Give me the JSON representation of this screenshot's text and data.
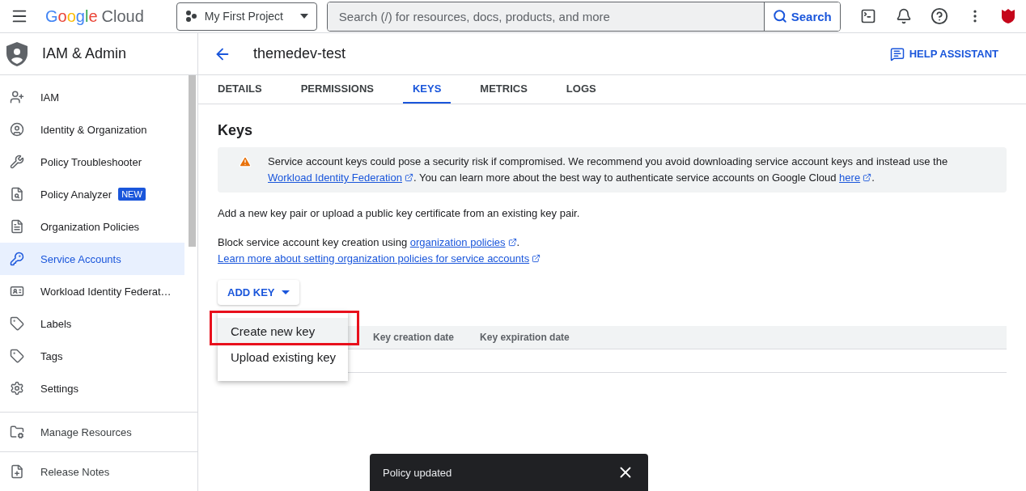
{
  "topbar": {
    "logo": {
      "brand": "Google",
      "product": "Cloud"
    },
    "project": "My First Project",
    "search": {
      "placeholder": "Search (/) for resources, docs, products, and more",
      "button": "Search"
    }
  },
  "sidebar": {
    "title": "IAM & Admin",
    "items": [
      {
        "label": "IAM",
        "selected": false
      },
      {
        "label": "Identity & Organization",
        "selected": false
      },
      {
        "label": "Policy Troubleshooter",
        "selected": false
      },
      {
        "label": "Policy Analyzer",
        "badge": "NEW",
        "selected": false
      },
      {
        "label": "Organization Policies",
        "selected": false
      },
      {
        "label": "Service Accounts",
        "selected": true
      },
      {
        "label": "Workload Identity Federat…",
        "selected": false
      },
      {
        "label": "Labels",
        "selected": false
      },
      {
        "label": "Tags",
        "selected": false
      },
      {
        "label": "Settings",
        "selected": false
      }
    ],
    "footer": [
      "Manage Resources",
      "Release Notes"
    ]
  },
  "header": {
    "title": "themedev-test",
    "help": "HELP ASSISTANT"
  },
  "tabs": [
    {
      "label": "DETAILS",
      "selected": false
    },
    {
      "label": "PERMISSIONS",
      "selected": false
    },
    {
      "label": "KEYS",
      "selected": true
    },
    {
      "label": "METRICS",
      "selected": false
    },
    {
      "label": "LOGS",
      "selected": false
    }
  ],
  "section_title": "Keys",
  "warning": [
    {
      "kind": "text",
      "text": "Service account keys could pose a security risk if compromised. We recommend you avoid downloading service account keys and instead use the "
    },
    {
      "kind": "link",
      "text": "Workload Identity Federation"
    },
    {
      "kind": "text",
      "text": ". You can learn more about the best way to authenticate service accounts on Google Cloud "
    },
    {
      "kind": "link",
      "text": "here"
    },
    {
      "kind": "text",
      "text": "."
    }
  ],
  "intro": "Add a new key pair or upload a public key certificate from an existing key pair.",
  "block_text": [
    {
      "kind": "text",
      "text": "Block service account key creation using "
    },
    {
      "kind": "link",
      "text": "organization policies"
    },
    {
      "kind": "text",
      "text": "."
    }
  ],
  "learn_more": "Learn more about setting organization policies for service accounts",
  "add_key": {
    "label": "ADD KEY",
    "menu": [
      {
        "label": "Create new key",
        "highlighted": true
      },
      {
        "label": "Upload existing key",
        "highlighted": false
      }
    ]
  },
  "table": {
    "columns": [
      "Key creation date",
      "Key expiration date"
    ]
  },
  "snackbar": {
    "message": "Policy updated"
  }
}
